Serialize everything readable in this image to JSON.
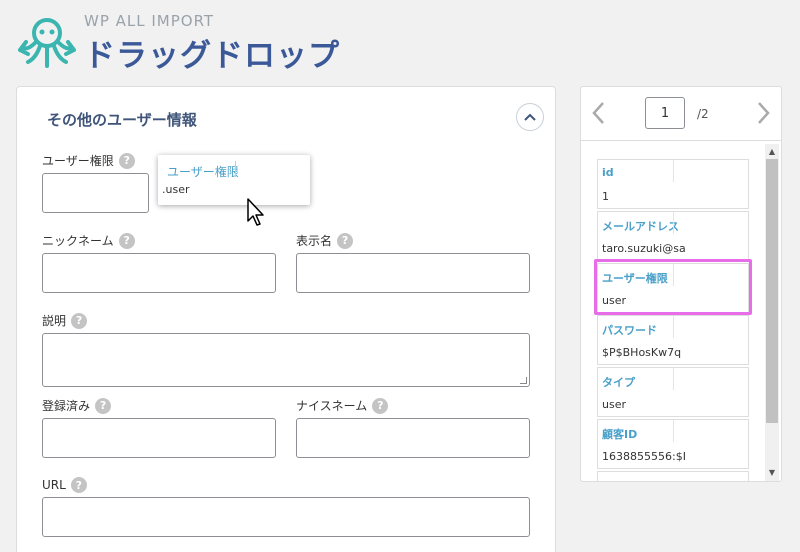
{
  "header": {
    "brand_top": "WP ALL IMPORT",
    "brand_main": "ドラッグドロップ",
    "logo_icon": "octopus-logo-icon",
    "accent": "#3b5998",
    "logo_color": "#3ab5b0"
  },
  "section": {
    "title": "その他のユーザー情報",
    "collapse_icon": "chevron-up-icon"
  },
  "fields": {
    "user_role": {
      "label": "ユーザー権限",
      "value": ""
    },
    "nickname": {
      "label": "ニックネーム",
      "value": ""
    },
    "display_name": {
      "label": "表示名",
      "value": ""
    },
    "description": {
      "label": "説明",
      "value": ""
    },
    "registered": {
      "label": "登録済み",
      "value": ""
    },
    "nicename": {
      "label": "ナイスネーム",
      "value": ""
    },
    "url": {
      "label": "URL",
      "value": ""
    }
  },
  "drag_chip": {
    "key": "ユーザー権限",
    "value": ".user"
  },
  "record_nav": {
    "current_page": "1",
    "total_pages": "/2",
    "prev_icon": "chevron-left-icon",
    "next_icon": "chevron-right-icon"
  },
  "record": [
    {
      "key": "id",
      "value": "1"
    },
    {
      "key": "メールアドレス",
      "value": "taro.suzuki@sa"
    },
    {
      "key": "ユーザー権限",
      "value": "user"
    },
    {
      "key": "パスワード",
      "value": "$P$BHosKw7q"
    },
    {
      "key": "タイプ",
      "value": "user"
    },
    {
      "key": "顧客ID",
      "value": "1638855556:$I"
    }
  ],
  "colors": {
    "highlight": "#e86de8",
    "field_key": "#4aa0c8"
  }
}
